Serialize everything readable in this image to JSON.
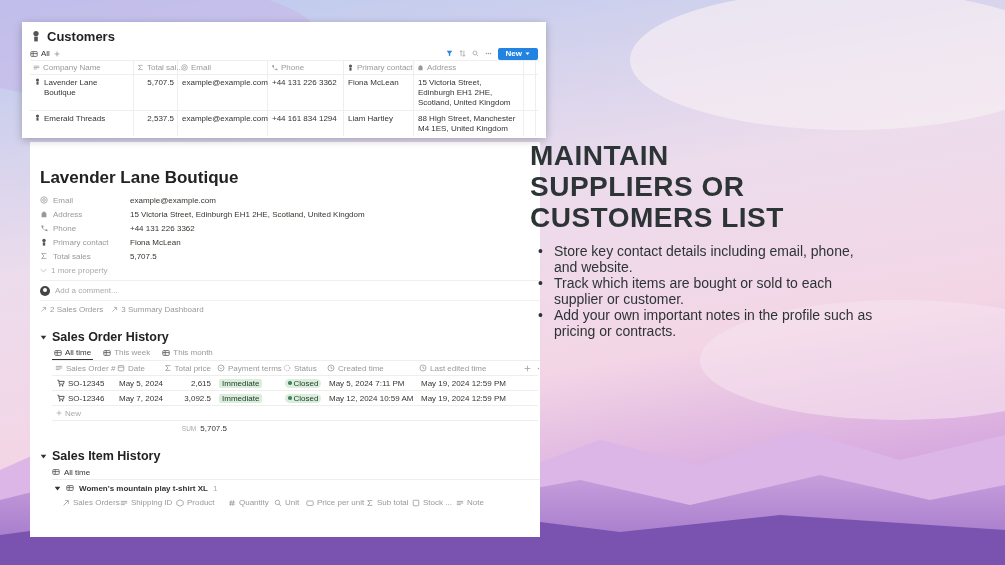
{
  "customers_view": {
    "title": "Customers",
    "view_tab": "All",
    "new_button": "New",
    "columns": [
      {
        "label": "Company Name",
        "kind": "title"
      },
      {
        "label": "Total sal...",
        "kind": "sigma"
      },
      {
        "label": "Email",
        "kind": "at"
      },
      {
        "label": "Phone",
        "kind": "phone"
      },
      {
        "label": "Primary contact",
        "kind": "person"
      },
      {
        "label": "Address",
        "kind": "building"
      }
    ],
    "rows": [
      {
        "cells": [
          "Lavender Lane Boutique",
          "5,707.5",
          "example@example.com",
          "+44 131 226 3362",
          "Fiona McLean",
          "15 Victoria Street, Edinburgh EH1 2HE, Scotland, United Kingdom"
        ]
      },
      {
        "cells": [
          "Emerald Threads",
          "2,537.5",
          "example@example.com",
          "+44 161 834 1294",
          "Liam Hartley",
          "88 High Street, Manchester M4 1ES, United Kingdom"
        ]
      }
    ]
  },
  "record": {
    "title": "Lavender Lane Boutique",
    "properties": [
      {
        "label": "Email",
        "kind": "at",
        "value": "example@example.com"
      },
      {
        "label": "Address",
        "kind": "building",
        "value": "15 Victoria Street, Edinburgh EH1 2HE, Scotland, United Kingdom"
      },
      {
        "label": "Phone",
        "kind": "phone",
        "value": "+44 131 226 3362"
      },
      {
        "label": "Primary contact",
        "kind": "person",
        "value": "Fiona McLean"
      },
      {
        "label": "Total sales",
        "kind": "sigma",
        "value": "5,707.5"
      }
    ],
    "more": "1 more property",
    "comment_placeholder": "Add a comment...",
    "relations": [
      "2 Sales Orders",
      "3 Summary Dashboard"
    ]
  },
  "sales_orders": {
    "title": "Sales Order History",
    "expanded": true,
    "tabs": [
      {
        "label": "All time",
        "selected": true
      },
      {
        "label": "This week",
        "selected": false
      },
      {
        "label": "This month",
        "selected": false
      }
    ],
    "columns": [
      {
        "label": "Sales Order #",
        "kind": "title"
      },
      {
        "label": "Date",
        "kind": "calendar"
      },
      {
        "label": "Total price",
        "kind": "sigma"
      },
      {
        "label": "Payment terms",
        "kind": "select"
      },
      {
        "label": "Status",
        "kind": "status"
      },
      {
        "label": "Created time",
        "kind": "clock"
      },
      {
        "label": "Last edited time",
        "kind": "clock"
      }
    ],
    "rows": [
      {
        "cells": [
          "SO-12345",
          "May 5, 2024",
          "2,615",
          "Immediate",
          "Closed",
          "May 5, 2024 7:11 PM",
          "May 19, 2024 12:59 PM"
        ]
      },
      {
        "cells": [
          "SO-12346",
          "May 7, 2024",
          "3,092.5",
          "Immediate",
          "Closed",
          "May 12, 2024 10:59 AM",
          "May 19, 2024 12:59 PM"
        ]
      }
    ],
    "new_row": "New",
    "sum_label": "SUM",
    "sum": "5,707.5"
  },
  "sales_items": {
    "title": "Sales Item History",
    "expanded": true,
    "view": "All time",
    "group": {
      "title": "Women's mountain play t-shirt XL",
      "count": "1",
      "expanded": true
    },
    "columns": [
      {
        "label": "Sales Orders",
        "kind": "relation"
      },
      {
        "label": "Shipping ID",
        "kind": "title"
      },
      {
        "label": "Product",
        "kind": "box"
      },
      {
        "label": "Quantity",
        "kind": "hash"
      },
      {
        "label": "Unit",
        "kind": "search"
      },
      {
        "label": "Price per unit",
        "kind": "card"
      },
      {
        "label": "Sub total",
        "kind": "sigma"
      },
      {
        "label": "Stock ...",
        "kind": "square"
      },
      {
        "label": "Note",
        "kind": "lines"
      }
    ]
  },
  "promo": {
    "heading": "MAINTAIN SUPPLIERS OR CUSTOMERS LIST",
    "marker": "•",
    "bullets": [
      "Store key contact details including email, phone, and website.",
      "Track which items are bought or sold to each supplier or customer.",
      "Add your own important notes in the profile such as pricing or contracts."
    ]
  }
}
